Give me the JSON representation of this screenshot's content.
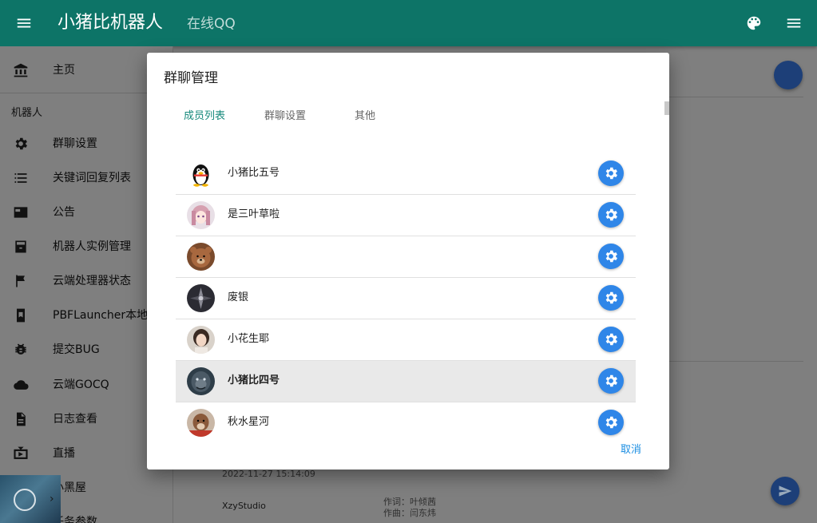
{
  "appbar": {
    "title": "小猪比机器人",
    "subtitle": "在线QQ",
    "color": "#0d7467"
  },
  "drawer": {
    "home": "主页",
    "section": "机器人",
    "items": [
      {
        "label": "群聊设置",
        "icon": "gear-icon"
      },
      {
        "label": "关键词回复列表",
        "icon": "list-icon"
      },
      {
        "label": "公告",
        "icon": "announcement-icon"
      },
      {
        "label": "机器人实例管理",
        "icon": "archive-icon"
      },
      {
        "label": "云端处理器状态",
        "icon": "flag-icon"
      },
      {
        "label": "PBFLauncher本地版",
        "icon": "book-icon"
      },
      {
        "label": "提交BUG",
        "icon": "bug-icon"
      },
      {
        "label": "云端GOCQ",
        "icon": "cloud-icon"
      },
      {
        "label": "日志查看",
        "icon": "file-icon"
      },
      {
        "label": "直播",
        "icon": "tv-icon"
      },
      {
        "label": "小黑屋",
        "icon": "player-icon"
      },
      {
        "label": "任务参数",
        "icon": "task-icon"
      }
    ]
  },
  "background": {
    "timestamp": "2022-11-27 15:14:09",
    "author": "XzyStudio",
    "lyric1": "作词：叶倾茜",
    "lyric2": "作曲：闫东炜"
  },
  "dialog": {
    "title": "群聊管理",
    "tabs": [
      "成员列表",
      "群聊设置",
      "其他"
    ],
    "active_tab": 0,
    "members": [
      {
        "name": "小猪比五号"
      },
      {
        "name": "是三叶草啦"
      },
      {
        "name": ""
      },
      {
        "name": "废银"
      },
      {
        "name": "小花生耶"
      },
      {
        "name": "小猪比四号",
        "selected": true
      },
      {
        "name": "秋水星河"
      }
    ],
    "cancel_label": "取消",
    "accent": "#16897b",
    "gear_button_color": "#2f86e8"
  }
}
